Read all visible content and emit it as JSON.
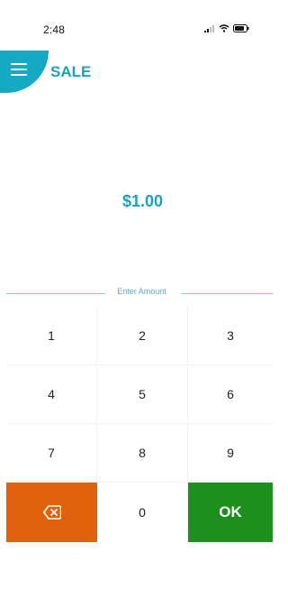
{
  "status_bar": {
    "time": "2:48",
    "icons": [
      "signal-icon",
      "wifi-icon",
      "battery-icon"
    ]
  },
  "header": {
    "menu_icon": "hamburger-menu-icon",
    "title": "SALE",
    "accent_color": "#16a9c4"
  },
  "amount": {
    "value": "$1.00"
  },
  "divider": {
    "label": "Enter Amount"
  },
  "keypad": {
    "keys": [
      "1",
      "2",
      "3",
      "4",
      "5",
      "6",
      "7",
      "8",
      "9"
    ],
    "backspace_icon": "backspace-icon",
    "zero": "0",
    "ok_label": "OK",
    "backspace_color": "#e0620f",
    "ok_color": "#1e8f1e"
  }
}
